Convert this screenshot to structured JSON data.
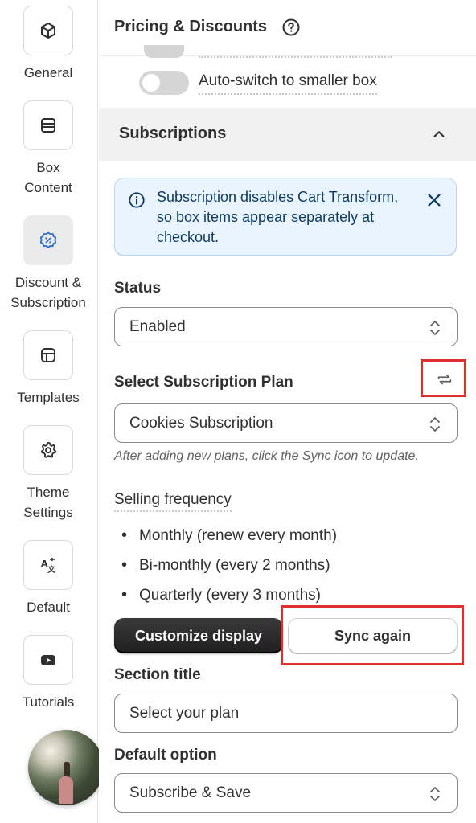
{
  "nav": {
    "items": [
      {
        "label": "General",
        "icon": "box-icon"
      },
      {
        "label": "Box Content",
        "icon": "list-icon"
      },
      {
        "label": "Discount & Subscription",
        "icon": "discount-icon"
      },
      {
        "label": "Templates",
        "icon": "layout-icon"
      },
      {
        "label": "Theme Settings",
        "icon": "gear-icon"
      },
      {
        "label": "Default",
        "icon": "translate-icon"
      },
      {
        "label": "Tutorials",
        "icon": "youtube-icon"
      }
    ],
    "active_index": 2
  },
  "header": {
    "title": "Pricing & Discounts"
  },
  "auto_switch": {
    "label": "Auto-switch to smaller box",
    "enabled": false
  },
  "section": {
    "title": "Subscriptions",
    "expanded": true
  },
  "banner": {
    "text_before": "Subscription disables ",
    "link_text": "Cart Transform",
    "text_after": ", so box items appear separately at checkout."
  },
  "status": {
    "label": "Status",
    "value": "Enabled"
  },
  "plan": {
    "label": "Select Subscription Plan",
    "value": "Cookies Subscription",
    "help": "After adding new plans, click the Sync icon to update."
  },
  "frequency": {
    "label": "Selling frequency",
    "items": [
      "Monthly (renew every month)",
      "Bi-monthly (every 2 months)",
      "Quarterly (every 3 months)"
    ]
  },
  "buttons": {
    "customize": "Customize display",
    "sync": "Sync again"
  },
  "section_title_field": {
    "label": "Section title",
    "value": "Select your plan"
  },
  "default_option": {
    "label": "Default option",
    "value": "Subscribe & Save"
  },
  "colors": {
    "highlight": "#e0302b",
    "banner_bg": "#eaf4ff",
    "dark_button": "#303030"
  }
}
